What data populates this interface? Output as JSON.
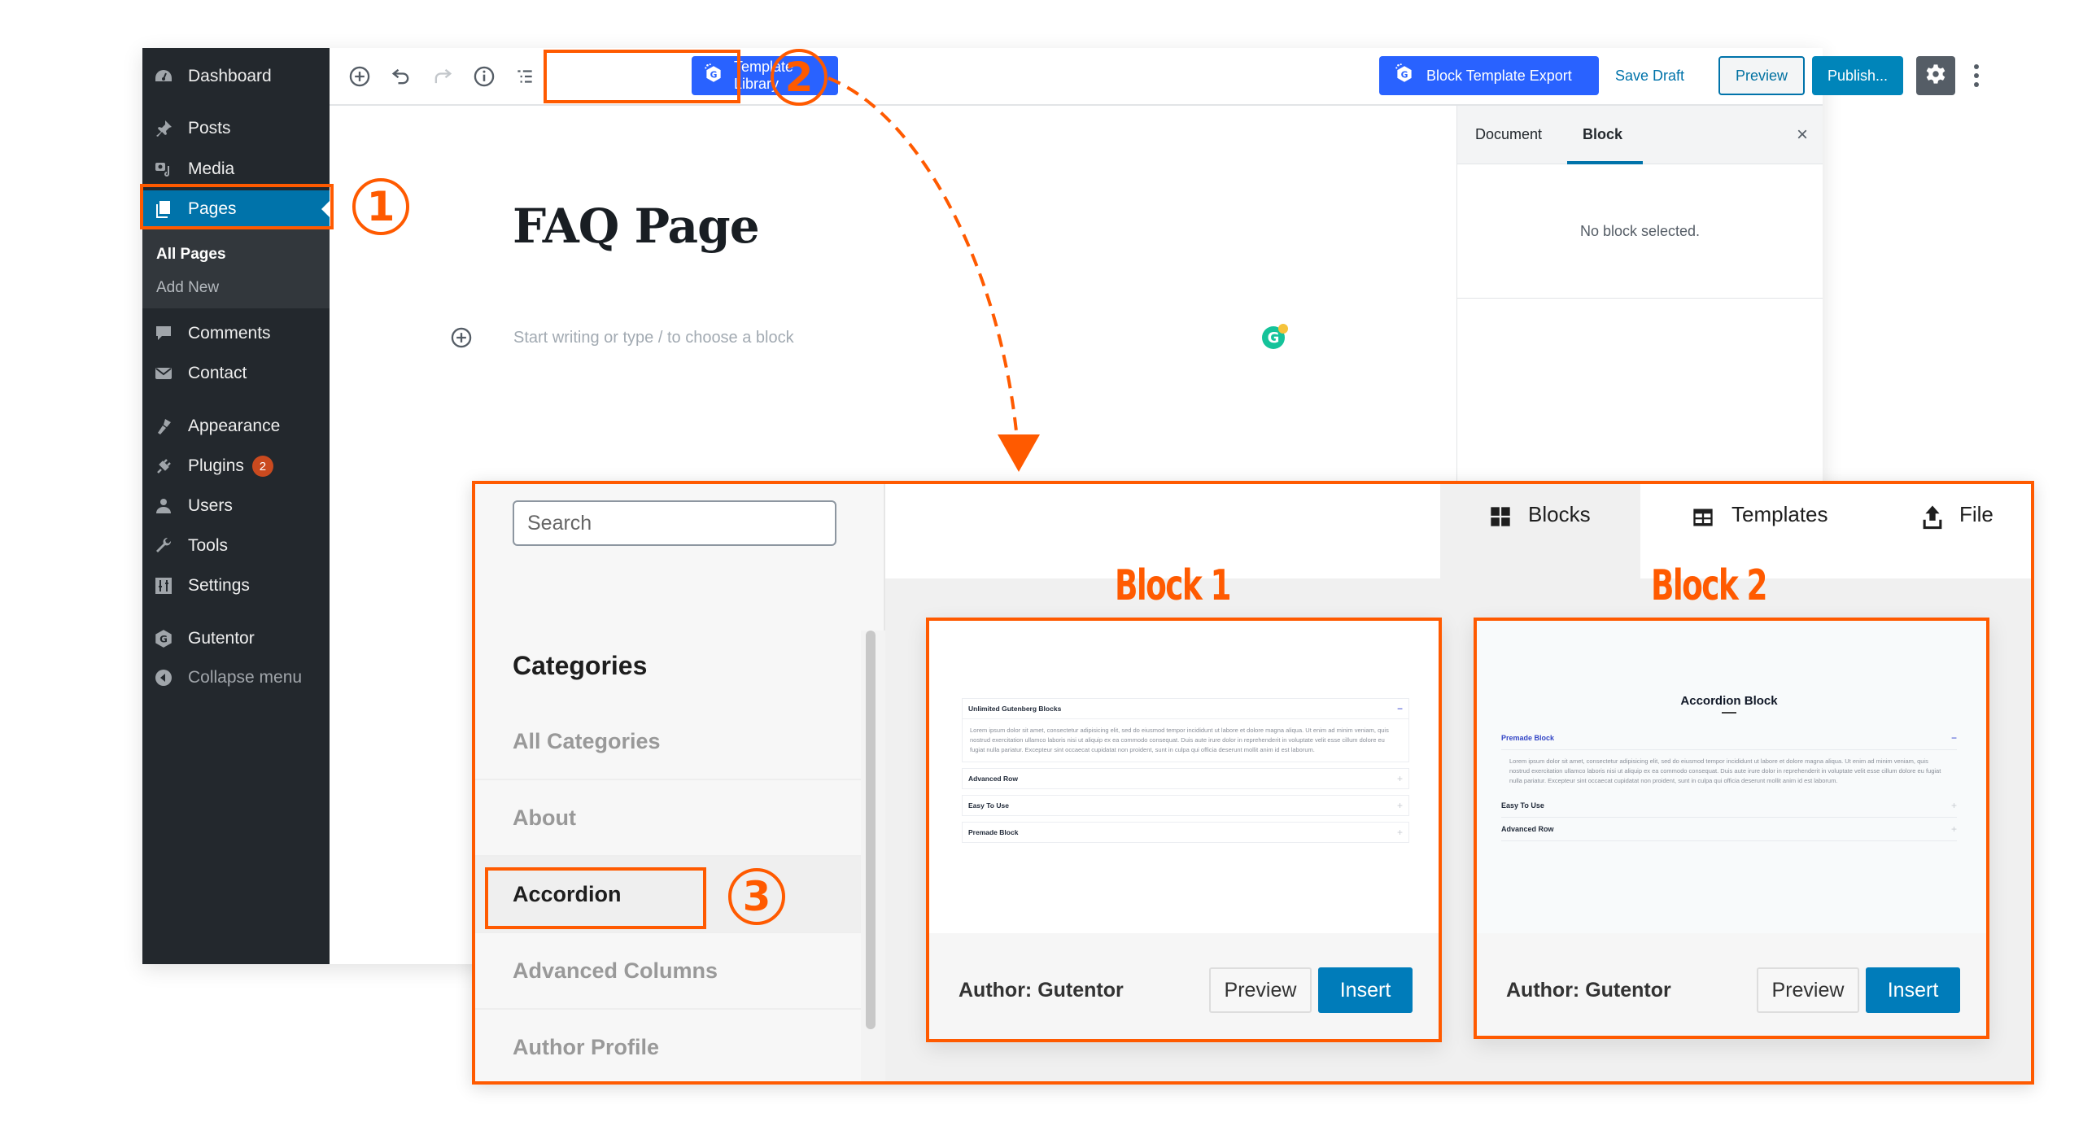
{
  "sidebar": {
    "items": [
      {
        "label": "Dashboard",
        "icon": "dashboard-icon"
      },
      {
        "label": "Posts",
        "icon": "pin-icon"
      },
      {
        "label": "Media",
        "icon": "media-icon"
      },
      {
        "label": "Pages",
        "icon": "pages-icon",
        "active": true
      },
      {
        "label": "Comments",
        "icon": "comment-icon"
      },
      {
        "label": "Contact",
        "icon": "envelope-icon"
      },
      {
        "label": "Appearance",
        "icon": "paintbrush-icon"
      },
      {
        "label": "Plugins",
        "icon": "plug-icon",
        "badge": "2"
      },
      {
        "label": "Users",
        "icon": "user-icon"
      },
      {
        "label": "Tools",
        "icon": "wrench-icon"
      },
      {
        "label": "Settings",
        "icon": "sliders-icon"
      },
      {
        "label": "Gutentor",
        "icon": "gutentor-icon"
      },
      {
        "label": "Collapse menu",
        "icon": "collapse-icon"
      }
    ],
    "submenu": [
      {
        "label": "All Pages",
        "current": true
      },
      {
        "label": "Add New"
      }
    ]
  },
  "toolbar": {
    "template_library_label": "Template Library",
    "block_template_export_label": "Block Template Export",
    "save_draft_label": "Save Draft",
    "preview_label": "Preview",
    "publish_label": "Publish..."
  },
  "editor": {
    "title": "FAQ Page",
    "placeholder": "Start writing or type / to choose a block"
  },
  "settings_panel": {
    "tabs": [
      "Document",
      "Block"
    ],
    "active_tab": "Block",
    "close_label": "×",
    "empty_message": "No block selected."
  },
  "library": {
    "search_placeholder": "Search",
    "categories_heading": "Categories",
    "categories": [
      "All Categories",
      "About",
      "Accordion",
      "Advanced Columns",
      "Author Profile"
    ],
    "selected_category": "Accordion",
    "tabs": [
      {
        "label": "Blocks",
        "icon": "grid-icon",
        "active": true
      },
      {
        "label": "Templates",
        "icon": "table-icon"
      },
      {
        "label": "File",
        "icon": "upload-icon"
      }
    ],
    "cards": [
      {
        "annotation": "Block 1",
        "author": "Author: Gutentor",
        "preview_label": "Preview",
        "insert_label": "Insert",
        "preview": {
          "rows": [
            {
              "title": "Unlimited Gutenberg Blocks",
              "open": true,
              "body": "Lorem ipsum dolor sit amet, consectetur adipisicing elit, sed do eiusmod tempor incididunt ut labore et dolore magna aliqua. Ut enim ad minim veniam, quis nostrud exercitation ullamco laboris nisi ut aliquip ex ea commodo consequat. Duis aute irure dolor in reprehenderit in voluptate velit esse cillum dolore eu fugiat nulla pariatur. Excepteur sint occaecat cupidatat non proident, sunt in culpa qui officia deserunt mollit anim id est laborum."
            },
            {
              "title": "Advanced Row",
              "open": false
            },
            {
              "title": "Easy To Use",
              "open": false
            },
            {
              "title": "Premade Block",
              "open": false
            }
          ]
        }
      },
      {
        "annotation": "Block 2",
        "author": "Author: Gutentor",
        "preview_label": "Preview",
        "insert_label": "Insert",
        "preview": {
          "heading": "Accordion Block",
          "rows": [
            {
              "title": "Premade Block",
              "open": true,
              "body": "Lorem ipsum dolor sit amet, consectetur adipisicing elit, sed do eiusmod tempor incididunt ut labore et dolore magna aliqua. Ut enim ad minim veniam, quis nostrud exercitation ullamco laboris nisi ut aliquip ex ea commodo consequat. Duis aute irure dolor in reprehenderit in voluptate velit esse cillum dolore eu fugiat nulla pariatur. Excepteur sint occaecat cupidatat non proident, sunt in culpa qui officia deserunt mollit anim id est laborum."
            },
            {
              "title": "Easy To Use",
              "open": false
            },
            {
              "title": "Advanced Row",
              "open": false
            }
          ]
        }
      }
    ]
  },
  "annotations": {
    "step1": "1",
    "step2": "2",
    "step3": "3",
    "color": "#ff5a00"
  },
  "colors": {
    "wp_admin_dark": "#23282d",
    "wp_blue": "#0073aa",
    "gutentor_blue": "#2962ff",
    "insert_blue": "#007cba",
    "badge_red": "#ca4a1f"
  }
}
